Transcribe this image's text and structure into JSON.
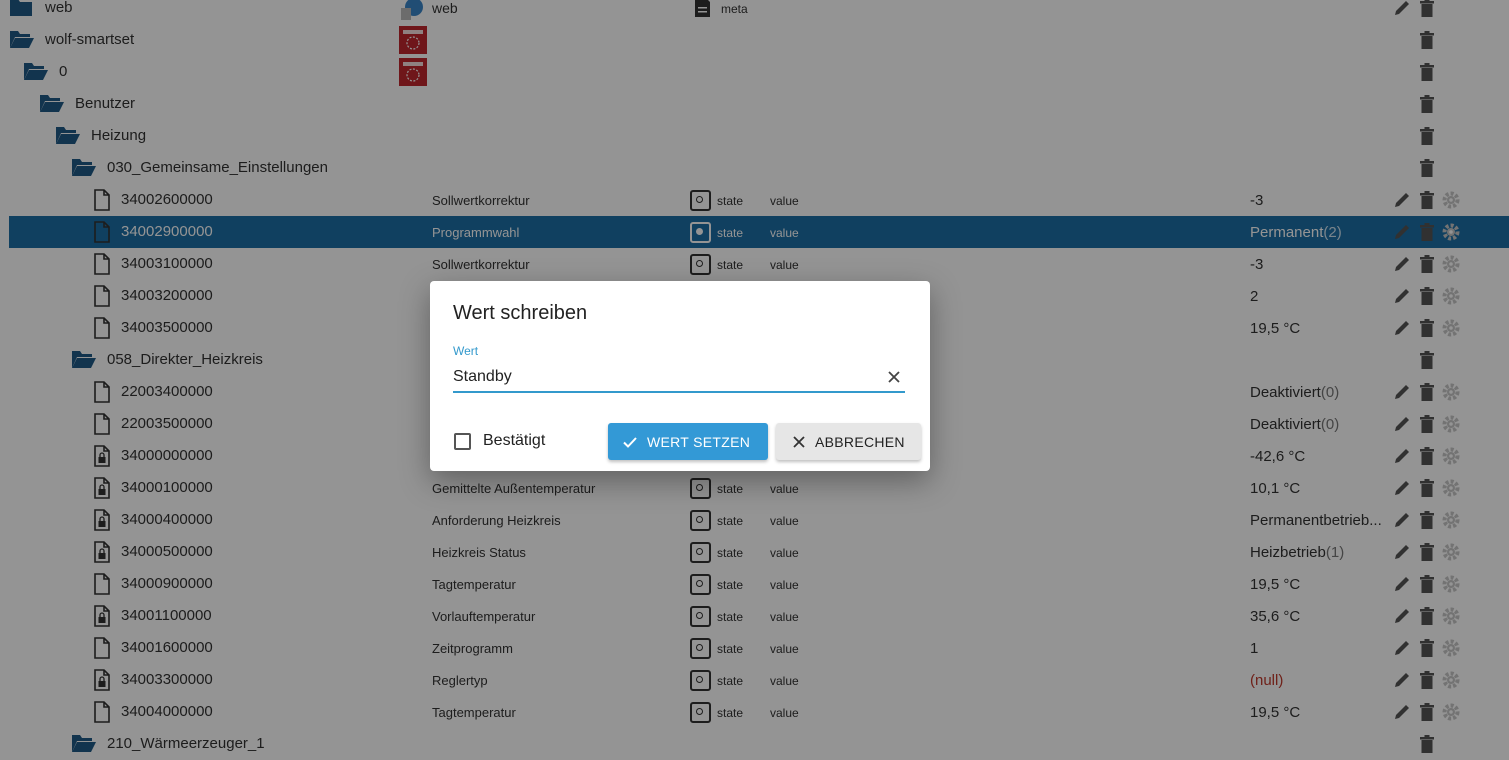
{
  "tree": {
    "rows": [
      {
        "name": "web",
        "kind": "folder",
        "level": 0,
        "obj_label": "web",
        "meta_label": "meta",
        "has_image": "web",
        "actions": [
          "edit",
          "delete"
        ]
      },
      {
        "name": "wolf-smartset",
        "kind": "folder-open",
        "level": 0,
        "has_image": "wolf",
        "actions": [
          "delete"
        ]
      },
      {
        "name": "0",
        "kind": "folder-open",
        "level": 1,
        "has_image": "wolf",
        "actions": [
          "delete"
        ]
      },
      {
        "name": "Benutzer",
        "kind": "folder-open",
        "level": 2,
        "actions": [
          "delete"
        ]
      },
      {
        "name": "Heizung",
        "kind": "folder-open",
        "level": 3,
        "actions": [
          "delete"
        ]
      },
      {
        "name": "030_Gemeinsame_Einstellungen",
        "kind": "folder-open",
        "level": 4,
        "actions": [
          "delete"
        ]
      },
      {
        "name": "34002600000",
        "kind": "file",
        "level": 5,
        "description": "Sollwertkorrektur",
        "type": "state",
        "role": "value",
        "value": "-3",
        "actions": [
          "edit",
          "delete",
          "settings"
        ]
      },
      {
        "name": "34002900000",
        "kind": "file",
        "level": 5,
        "description": "Programmwahl",
        "type": "state",
        "role": "value",
        "value": "Permanent",
        "value_sub": "(2)",
        "selected": true,
        "actions": [
          "edit",
          "delete",
          "settings"
        ]
      },
      {
        "name": "34003100000",
        "kind": "file",
        "level": 5,
        "description": "Sollwertkorrektur",
        "type": "state",
        "role": "value",
        "value": "-3",
        "actions": [
          "edit",
          "delete",
          "settings"
        ]
      },
      {
        "name": "34003200000",
        "kind": "file",
        "level": 5,
        "value": "2",
        "actions": [
          "edit",
          "delete",
          "settings"
        ]
      },
      {
        "name": "34003500000",
        "kind": "file",
        "level": 5,
        "value": "19,5 °C",
        "actions": [
          "edit",
          "delete",
          "settings"
        ]
      },
      {
        "name": "058_Direkter_Heizkreis",
        "kind": "folder-open",
        "level": 4,
        "actions": [
          "delete"
        ]
      },
      {
        "name": "22003400000",
        "kind": "file",
        "level": 5,
        "value": "Deaktiviert",
        "value_sub": "(0)",
        "actions": [
          "edit",
          "delete",
          "settings"
        ]
      },
      {
        "name": "22003500000",
        "kind": "file",
        "level": 5,
        "value": "Deaktiviert",
        "value_sub": "(0)",
        "actions": [
          "edit",
          "delete",
          "settings"
        ]
      },
      {
        "name": "34000000000",
        "kind": "file-lock",
        "level": 5,
        "value": "-42,6 °C",
        "actions": [
          "edit",
          "delete",
          "settings"
        ]
      },
      {
        "name": "34000100000",
        "kind": "file-lock",
        "level": 5,
        "description": "Gemittelte Außentemperatur",
        "type": "state",
        "role": "value",
        "value": "10,1 °C",
        "actions": [
          "edit",
          "delete",
          "settings"
        ]
      },
      {
        "name": "34000400000",
        "kind": "file-lock",
        "level": 5,
        "description": "Anforderung Heizkreis",
        "type": "state",
        "role": "value",
        "value": "Permanentbetrieb...",
        "actions": [
          "edit",
          "delete",
          "settings"
        ]
      },
      {
        "name": "34000500000",
        "kind": "file-lock",
        "level": 5,
        "description": "Heizkreis Status",
        "type": "state",
        "role": "value",
        "value": "Heizbetrieb",
        "value_sub": "(1)",
        "actions": [
          "edit",
          "delete",
          "settings"
        ]
      },
      {
        "name": "34000900000",
        "kind": "file",
        "level": 5,
        "description": "Tagtemperatur",
        "type": "state",
        "role": "value",
        "value": "19,5 °C",
        "actions": [
          "edit",
          "delete",
          "settings"
        ]
      },
      {
        "name": "34001100000",
        "kind": "file-lock",
        "level": 5,
        "description": "Vorlauftemperatur",
        "type": "state",
        "role": "value",
        "value": "35,6 °C",
        "actions": [
          "edit",
          "delete",
          "settings"
        ]
      },
      {
        "name": "34001600000",
        "kind": "file",
        "level": 5,
        "description": "Zeitprogramm",
        "type": "state",
        "role": "value",
        "value": "1",
        "actions": [
          "edit",
          "delete",
          "settings"
        ]
      },
      {
        "name": "34003300000",
        "kind": "file-lock",
        "level": 5,
        "description": "Reglertyp",
        "type": "state",
        "role": "value",
        "value": "(null)",
        "value_null": true,
        "actions": [
          "edit",
          "delete",
          "settings"
        ]
      },
      {
        "name": "34004000000",
        "kind": "file",
        "level": 5,
        "description": "Tagtemperatur",
        "type": "state",
        "role": "value",
        "value": "19,5 °C",
        "actions": [
          "edit",
          "delete",
          "settings"
        ]
      },
      {
        "name": "210_Wärmeerzeuger_1",
        "kind": "folder-open",
        "level": 4,
        "actions": [
          "delete"
        ]
      }
    ]
  },
  "dialog": {
    "title": "Wert schreiben",
    "field_label": "Wert",
    "field_value": "Standby",
    "checkbox_label": "Bestätigt",
    "checkbox_checked": false,
    "ok_label": "WERT SETZEN",
    "cancel_label": "ABBRECHEN"
  },
  "colors": {
    "selected_row": "#1d6fa5",
    "accent": "#3399d6",
    "folder": "#1f5a87",
    "null_value": "#c0392b"
  },
  "icons": {
    "folder": "folder-icon",
    "folder_open": "folder-open-icon",
    "file": "file-icon",
    "file_lock": "file-lock-icon",
    "edit": "pencil-icon",
    "delete": "trash-icon",
    "settings": "gear-icon",
    "role": "role-value-icon",
    "ok": "check-icon",
    "cancel": "close-icon",
    "clear": "clear-icon",
    "meta": "meta-file-icon"
  }
}
